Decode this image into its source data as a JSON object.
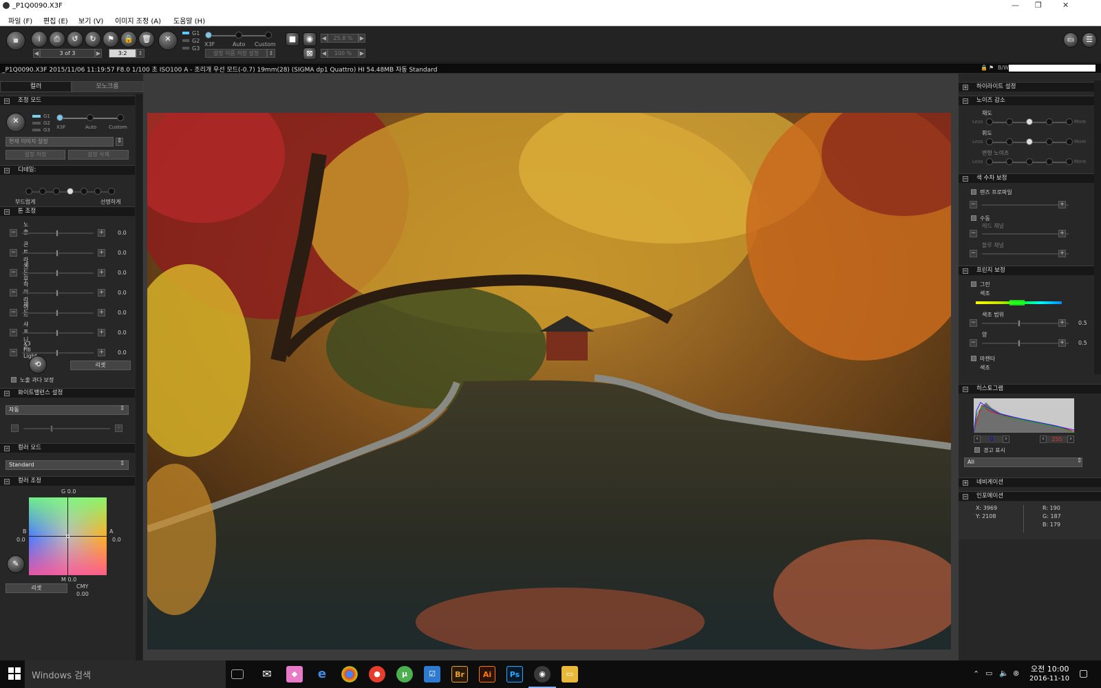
{
  "window": {
    "title": "_P1Q0090.X3F"
  },
  "menu": [
    "파일 (F)",
    "편집 (E)",
    "보기 (V)",
    "이미지 조정 (A)",
    "도움말 (H)"
  ],
  "toolbar": {
    "counter": "3 of 3",
    "ratio": "3:2",
    "groups": [
      "G1",
      "G2",
      "G3"
    ],
    "modes": [
      "X3F",
      "Auto",
      "Custom"
    ],
    "settings_placeholder": "설정 이름 저장 설정",
    "zoom1": "25.8 %",
    "zoom2": "100 %"
  },
  "infobar": {
    "text": "_P1Q0090.X3F 2015/11/06 11:19:57 F8.0 1/100 초 ISO100 A - 조리개 우선 모드(-0.7) 19mm(28) (SIGMA dp1 Quattro) HI 54.48MB 자동 Standard",
    "bw": "B/W"
  },
  "left": {
    "tabs": [
      "컬러",
      "모노크롬"
    ],
    "mode_section": "조정 모드",
    "groups": [
      "G1",
      "G2",
      "G3"
    ],
    "modes": [
      "X3F",
      "Auto",
      "Custom"
    ],
    "preset": "현재 이미지 설정",
    "save_btn": "설정 저장",
    "delete_btn": "설정 삭제",
    "detail_section": "디테일:",
    "detail_left": "부드럽게",
    "detail_right": "선명하게",
    "tone_section": "톤 조정",
    "sliders": [
      {
        "label": "노출",
        "value": "0.0"
      },
      {
        "label": "콘트라스트",
        "value": "0.0"
      },
      {
        "label": "섀도우",
        "value": "0.0"
      },
      {
        "label": "하이라이트",
        "value": "0.0"
      },
      {
        "label": "채도",
        "value": "0.0"
      },
      {
        "label": "샤프니스",
        "value": "0.0"
      },
      {
        "label": "X3 Fill Light",
        "value": "0.0"
      }
    ],
    "reset": "리셋",
    "overexposure": "노출 과다 보정",
    "wb_section": "화이트밸런스 설정",
    "wb_value": "자동",
    "colormode_section": "컬러 모드",
    "colormode_value": "Standard",
    "coloradj_section": "컬러 조정",
    "g_label": "G 0.0",
    "m_label": "M 0.0",
    "b_label": "B",
    "b_value": "0.0",
    "a_label": "A",
    "a_value": "0.0",
    "reset2": "리셋",
    "cmy_label": "CMY",
    "cmy_value": "0.00"
  },
  "right": {
    "highlight_section": "하이라이트 설정",
    "noise_section": "노이즈 감소",
    "noise_rows": [
      {
        "label": "채도",
        "less": "Less",
        "more": "More"
      },
      {
        "label": "휘도",
        "less": "Less",
        "more": "More"
      },
      {
        "label": "변형 노이즈",
        "less": "Less",
        "more": "More"
      }
    ],
    "aberration_section": "색 수차 보정",
    "lens_profile": "렌즈 프로파일",
    "manual": "수동",
    "red_channel": "레드 채널",
    "blue_channel": "블루 채널",
    "fringe_section": "프린지 보정",
    "green": "그린",
    "hue": "색조",
    "hue_range": "색조 범위",
    "amount": "양",
    "val_05a": "0.5",
    "val_05b": "0.5",
    "magenta": "마젠타",
    "hue2": "색조",
    "histogram_section": "히스토그램",
    "hist_min": "0",
    "hist_max": "255",
    "warning": "경고 표시",
    "channel": "All",
    "navigation_section": "네비게이션",
    "info_section": "인포메이션",
    "info": {
      "x": "X: 3969",
      "y": "Y: 2108",
      "r": "R:  190",
      "g": "G:  187",
      "b": "B:  179"
    }
  },
  "taskbar": {
    "search": "Windows 검색",
    "time": "오전 10:00",
    "date": "2016-11-10"
  }
}
